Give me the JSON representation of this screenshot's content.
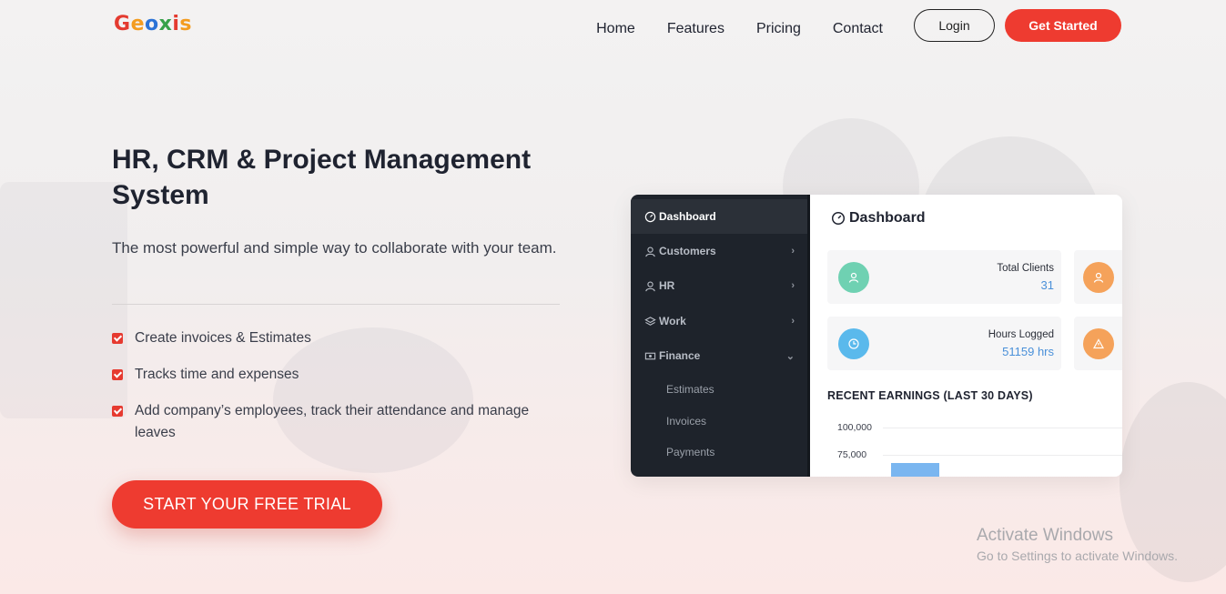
{
  "brand": {
    "letters": [
      {
        "char": "G",
        "color": "#e43b30"
      },
      {
        "char": "e",
        "color": "#f39c1f"
      },
      {
        "char": "o",
        "color": "#2b73d6"
      },
      {
        "char": "x",
        "color": "#37a14a"
      },
      {
        "char": "i",
        "color": "#e43b30"
      },
      {
        "char": "s",
        "color": "#f39c1f"
      }
    ]
  },
  "nav": {
    "links": [
      "Home",
      "Features",
      "Pricing",
      "Contact"
    ],
    "login_label": "Login",
    "get_started_label": "Get Started"
  },
  "hero": {
    "title": "HR, CRM & Project Management System",
    "subtitle": "The most powerful and simple way to collaborate with your team.",
    "features": [
      "Create invoices & Estimates",
      "Tracks time and expenses",
      "Add company’s employees, track their attendance and manage leaves"
    ],
    "cta_label": "START YOUR FREE TRIAL"
  },
  "dashboard": {
    "sidebar": {
      "items": [
        {
          "label": "Dashboard",
          "icon": "gauge-icon"
        },
        {
          "label": "Customers",
          "icon": "user-icon"
        },
        {
          "label": "HR",
          "icon": "user-icon"
        },
        {
          "label": "Work",
          "icon": "layers-icon"
        },
        {
          "label": "Finance",
          "icon": "money-icon"
        }
      ],
      "finance_subitems": [
        "Estimates",
        "Invoices",
        "Payments"
      ]
    },
    "title": "Dashboard",
    "cards": [
      {
        "label": "Total Clients",
        "value": "31",
        "color": "#6fd1b2"
      },
      {
        "label": "Hours Logged",
        "value": "51159 hrs",
        "color": "#5ab9ec"
      }
    ],
    "side_card_colors": [
      "#f5a25a",
      "#f5a25a"
    ],
    "earnings": {
      "title": "RECENT EARNINGS (LAST 30 DAYS)",
      "ticks": [
        "100,000",
        "75,000"
      ]
    }
  },
  "watermark": {
    "line1": "Activate Windows",
    "line2": "Go to Settings to activate Windows."
  },
  "colors": {
    "accent": "#ee3b30",
    "sidebar_bg": "#1e232b",
    "value_blue": "#4a90d9"
  }
}
